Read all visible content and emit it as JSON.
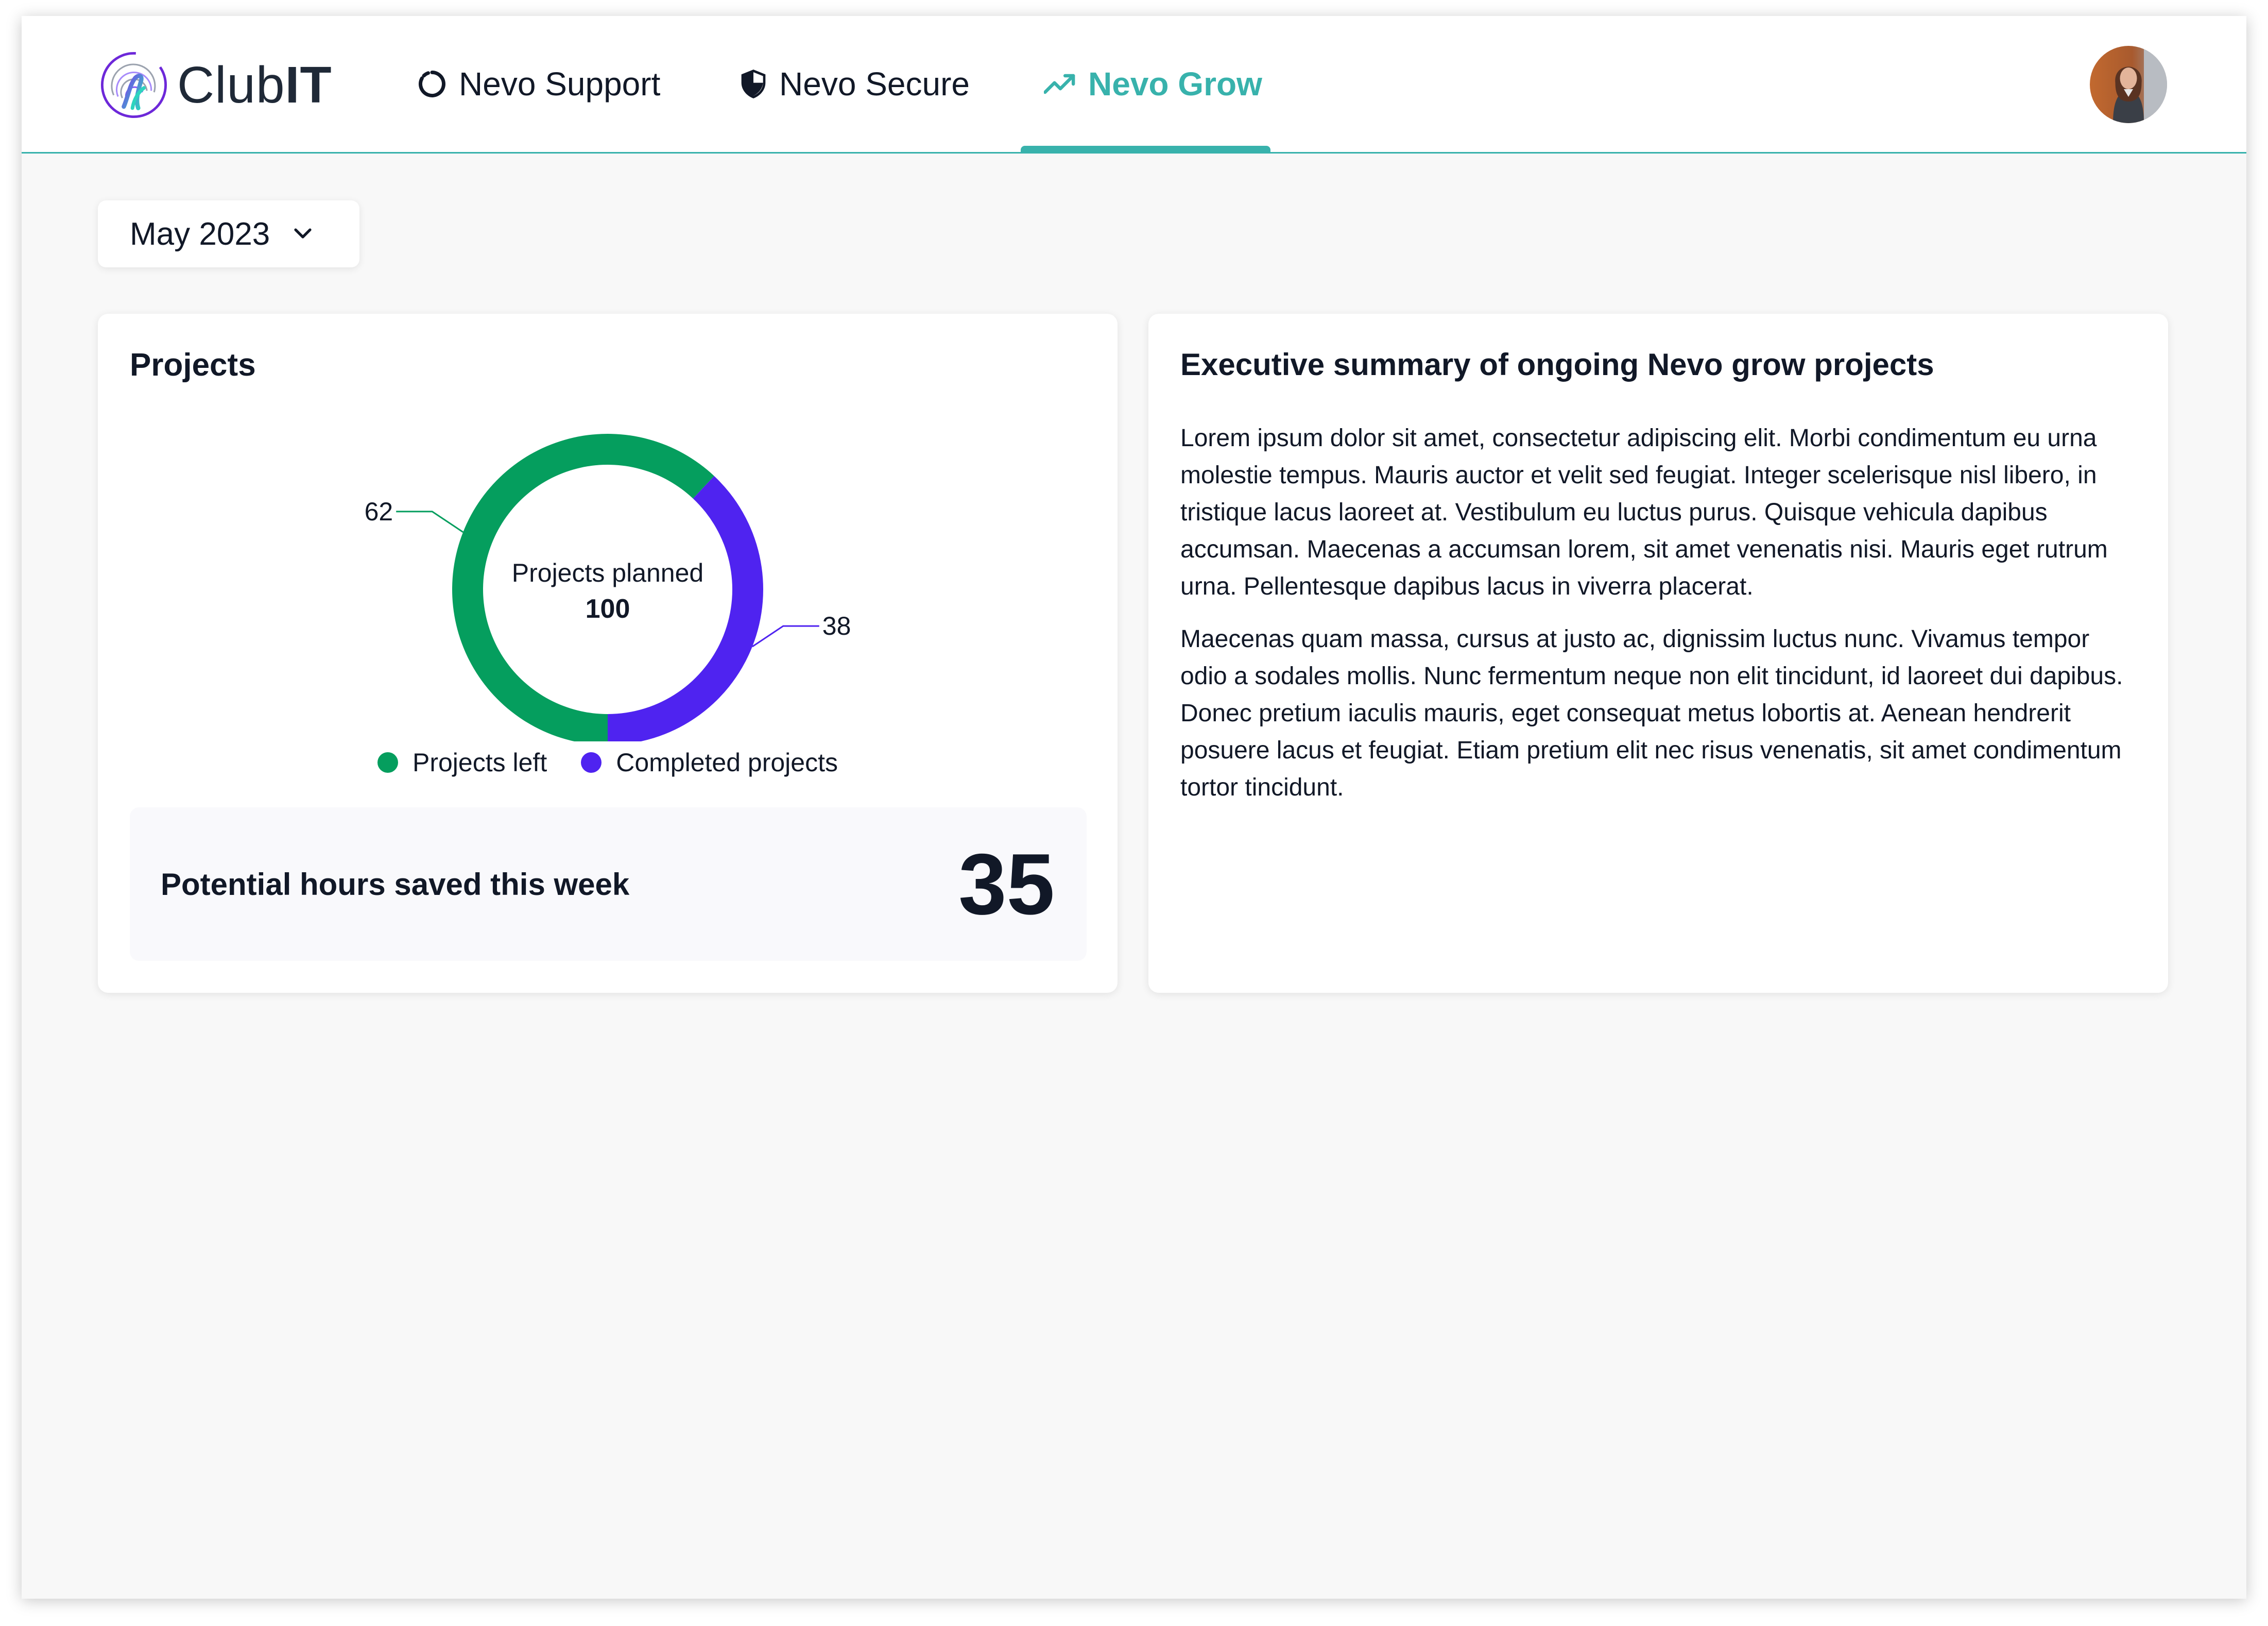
{
  "header": {
    "logo_text_light": "Club",
    "logo_text_bold": "IT",
    "nav": [
      {
        "label": "Nevo Support",
        "icon": "loading-ring-icon",
        "active": false
      },
      {
        "label": "Nevo Secure",
        "icon": "shield-icon",
        "active": false
      },
      {
        "label": "Nevo Grow",
        "icon": "trending-up-icon",
        "active": true
      }
    ],
    "accent_color": "#38b2ac"
  },
  "filter": {
    "selected": "May 2023",
    "icon": "chevron-down-icon"
  },
  "projects_card": {
    "title": "Projects",
    "center_label": "Projects planned",
    "center_value": "100",
    "hours_label": "Potential hours saved this week",
    "hours_value": "35"
  },
  "chart_data": {
    "type": "pie",
    "variant": "donut",
    "total": 100,
    "slices": [
      {
        "name": "Projects left",
        "value": 62,
        "label": "62",
        "color": "#059e5e"
      },
      {
        "name": "Completed projects",
        "value": 38,
        "label": "38",
        "color": "#4f23f0"
      }
    ],
    "legend_position": "bottom"
  },
  "summary_card": {
    "title": "Executive summary of ongoing Nevo grow projects",
    "paragraphs": [
      "Lorem ipsum dolor sit amet, consectetur adipiscing elit. Morbi condimentum eu urna molestie tempus. Mauris auctor et velit sed feugiat. Integer scelerisque nisl libero, in tristique lacus laoreet at. Vestibulum eu luctus purus. Quisque vehicula dapibus accumsan. Maecenas a accumsan lorem, sit amet venenatis nisi. Mauris eget rutrum urna. Pellentesque dapibus lacus in viverra placerat.",
      "Maecenas quam massa, cursus at justo ac, dignissim luctus nunc. Vivamus tempor odio a sodales mollis. Nunc fermentum neque non elit tincidunt, id laoreet dui dapibus. Donec pretium iaculis mauris, eget consequat metus lobortis at. Aenean hendrerit posuere lacus et feugiat. Etiam pretium elit nec risus venenatis, sit amet condimentum tortor tincidunt."
    ]
  }
}
